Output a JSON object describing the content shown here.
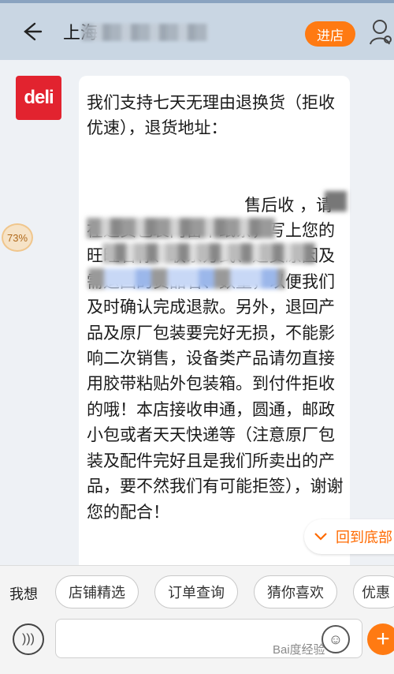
{
  "header": {
    "title": "上海",
    "enter_store_label": "进店"
  },
  "chat": {
    "avatar_text": "deli",
    "progress_text": "73%",
    "message": "我们支持七天无理由退换货（拒收优速），退货地址：\n\n\n                              售后收 ，请在退货包裹内留下纸条，写上您的旺旺名称、联系方式、退货原因及需退回的货品名、数量，以便我们及时确认完成退款。另外，退回产品及原厂包装要完好无损，不能影响二次销售，设备类产品请勿直接用胶带粘贴外包装箱。到付件拒收的哦！本店接收申通，圆通，邮政小包或者天天快递等（注意原厂包装及配件完好且是我们所卖出的产品，要不然我们有可能拒签），谢谢您的配合！",
    "back_to_bottom_label": "回到底部"
  },
  "quick_bar": {
    "label": "我想",
    "chips": [
      "店铺精选",
      "订单查询",
      "猜你喜欢",
      "优惠"
    ]
  },
  "watermark": "Bai度经验",
  "colors": {
    "accent": "#ff7a12",
    "header_bg": "#c9d6e3",
    "brand_red": "#e2232f"
  }
}
